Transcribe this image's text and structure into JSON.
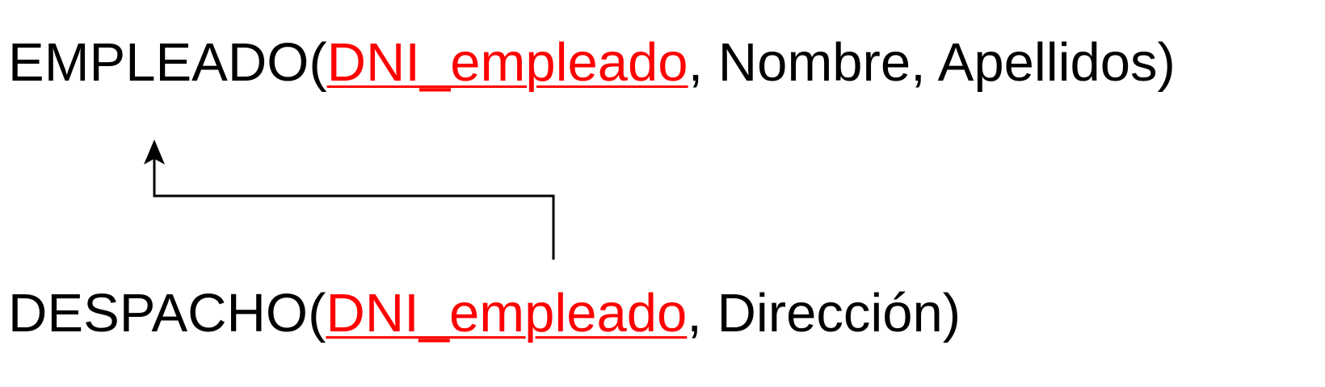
{
  "relations": [
    {
      "name": "EMPLEADO",
      "key": "DNI_empleado",
      "rest": "Nombre, Apellidos"
    },
    {
      "name": "DESPACHO",
      "key": "DNI_empleado",
      "rest": "Dirección"
    }
  ],
  "colors": {
    "key": "#ff0000",
    "text": "#000000",
    "arrow": "#000000"
  },
  "punctuation": {
    "open": "(",
    "sep": ", ",
    "close": ")"
  }
}
